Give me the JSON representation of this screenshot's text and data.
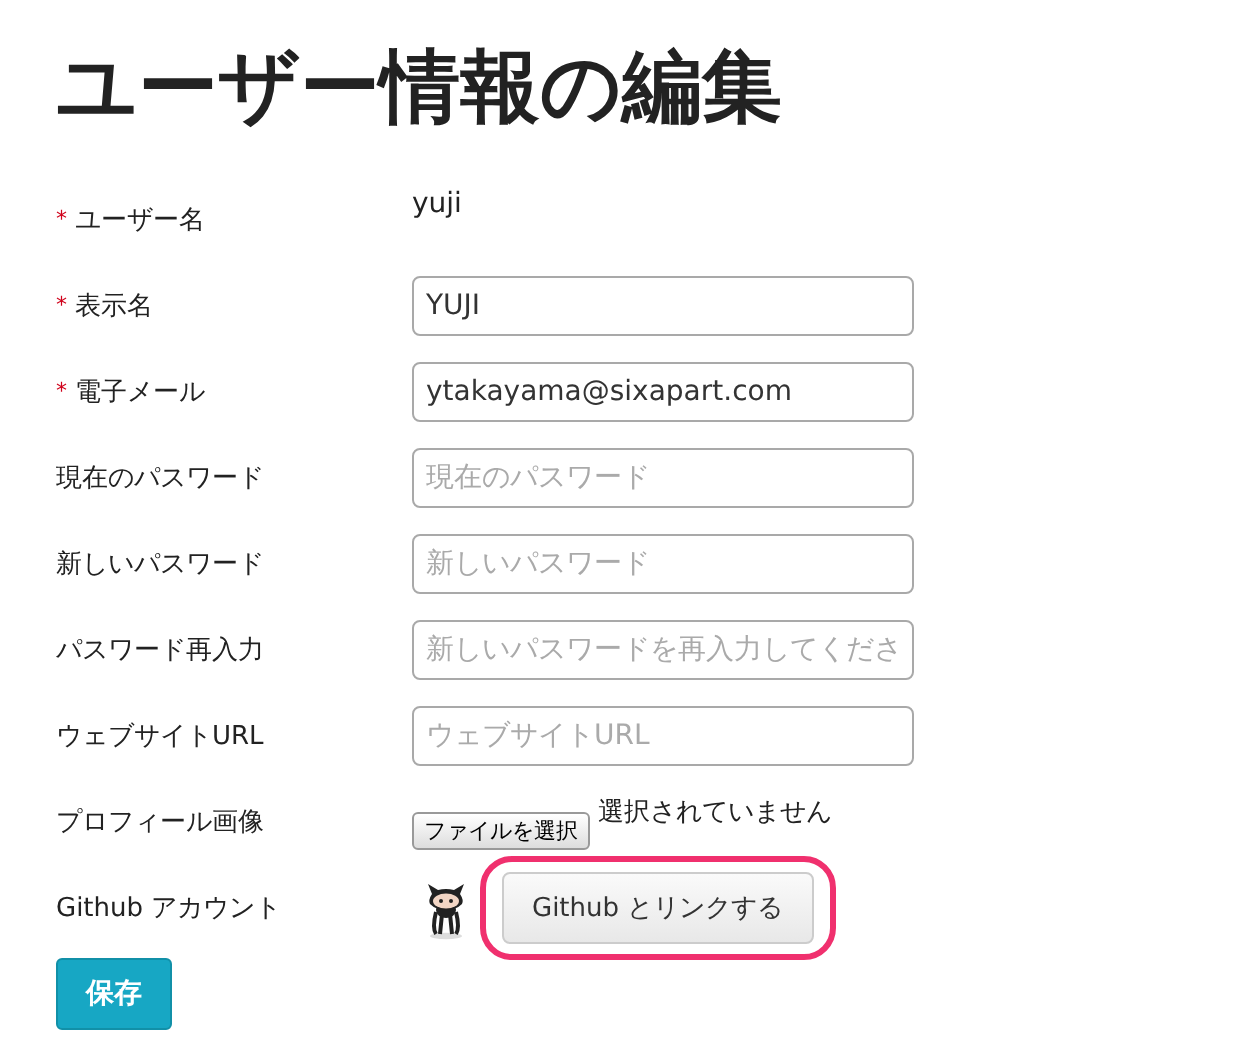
{
  "title": "ユーザー情報の編集",
  "fields": [
    {
      "kind": "static",
      "label": "ユーザー名",
      "mark": "*",
      "value": "yuji"
    },
    {
      "kind": "input",
      "label": "表示名",
      "mark": "*",
      "value": "YUJI"
    },
    {
      "kind": "input",
      "label": "電子メール",
      "mark": "*",
      "value": "ytakayama@sixapart.com"
    },
    {
      "kind": "input",
      "label": "現在のパスワード",
      "placeholder": "現在のパスワード"
    },
    {
      "kind": "input",
      "label": "新しいパスワード",
      "placeholder": "新しいパスワード"
    },
    {
      "kind": "input",
      "label": "パスワード再入力",
      "placeholder": "新しいパスワードを再入力してくださ"
    },
    {
      "kind": "input",
      "label": "ウェブサイトURL",
      "placeholder": "ウェブサイトURL"
    },
    {
      "kind": "file",
      "label": "プロフィール画像",
      "button": "ファイルを選択",
      "status": "選択されていません"
    },
    {
      "kind": "github",
      "label": "Github アカウント",
      "button": "Github とリンクする",
      "highlighted": true
    }
  ],
  "save_button": "保存"
}
